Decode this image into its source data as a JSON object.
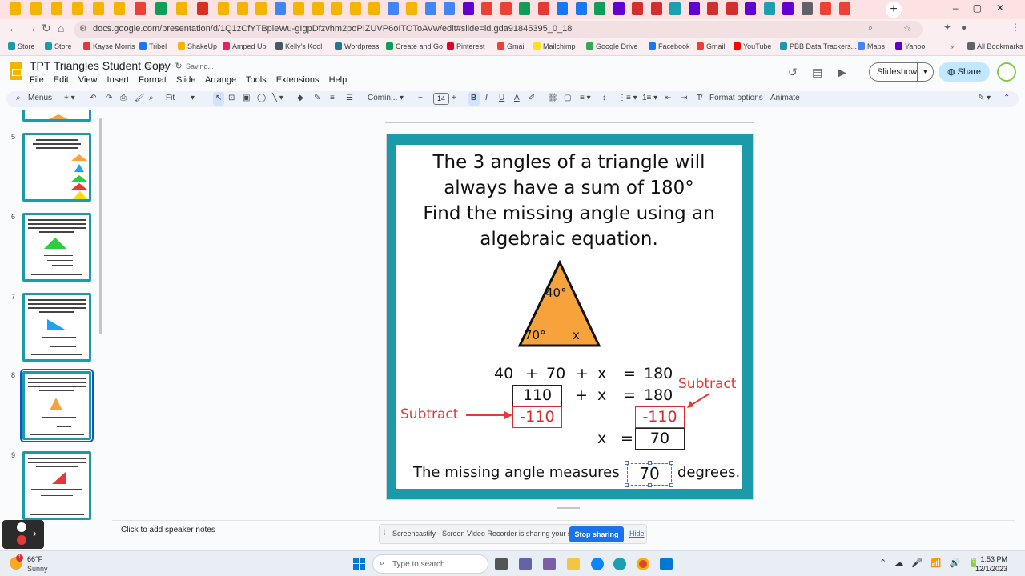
{
  "browser": {
    "url": "docs.google.com/presentation/d/1Q1zCfYTBpleWu-gIgpDfzvhm2poPIZUVP6oITOToAVw/edit#slide=id.gda91845395_0_18",
    "bookmarks": [
      "Store",
      "Store",
      "Kayse Morris",
      "Tribel",
      "ShakeUp",
      "Amped Up",
      "Kelly's Kool",
      "Wordpress",
      "Create and Go",
      "Pinterest",
      "Gmail",
      "Mailchimp",
      "Google Drive",
      "Facebook",
      "Gmail",
      "YouTube",
      "PBB Data Trackers...",
      "Maps",
      "Yahoo"
    ],
    "all_bookmarks": "All Bookmarks",
    "more_bookmarks": "»"
  },
  "doc": {
    "title": "TPT Triangles Student Copy",
    "saving": "Saving...",
    "menu": [
      "File",
      "Edit",
      "View",
      "Insert",
      "Format",
      "Slide",
      "Arrange",
      "Tools",
      "Extensions",
      "Help"
    ],
    "slideshow": "Slideshow",
    "share": "Share"
  },
  "toolbar": {
    "menus": "Menus",
    "zoom": "Fit",
    "font": "Comin...",
    "font_size": "14",
    "format_options": "Format options",
    "animate": "Animate"
  },
  "filmstrip": {
    "numbers": [
      "5",
      "6",
      "7",
      "8",
      "9"
    ],
    "selected": "8"
  },
  "slide": {
    "title_lines": [
      "The 3 angles of a triangle will",
      "always have a sum of 180°",
      "Find the missing angle using an",
      "algebraic equation."
    ],
    "angle_top": "40°",
    "angle_left": "70°",
    "angle_right": "x",
    "eq1": {
      "a": "40",
      "plus1": "+",
      "b": "70",
      "plus2": "+",
      "x": "x",
      "eq": "=",
      "total": "180"
    },
    "eq2": {
      "box": "110",
      "plus": "+",
      "x": "x",
      "eq": "=",
      "total": "180"
    },
    "subtract_left": "Subtract",
    "subtract_right": "Subtract",
    "neg_left": "-110",
    "neg_right": "-110",
    "eq3": {
      "x": "x",
      "eq": "=",
      "result": "70"
    },
    "sentence_pre": "The missing angle measures",
    "answer": "70",
    "sentence_post": "degrees."
  },
  "notes": {
    "placeholder": "Click to add speaker notes"
  },
  "screencastify": {
    "message": "Screencastify - Screen Video Recorder is sharing your screen.",
    "stop": "Stop sharing",
    "hide": "Hide"
  },
  "taskbar": {
    "weather_badge": "1",
    "temp": "66°F",
    "condition": "Sunny",
    "search_placeholder": "Type to search",
    "time": "1:53 PM",
    "date": "12/1/2023"
  },
  "colors": {
    "teal_frame": "#1b9aaa",
    "triangle_fill": "#f6a33b",
    "red": "#e53935",
    "share_bg": "#c2e7ff"
  }
}
